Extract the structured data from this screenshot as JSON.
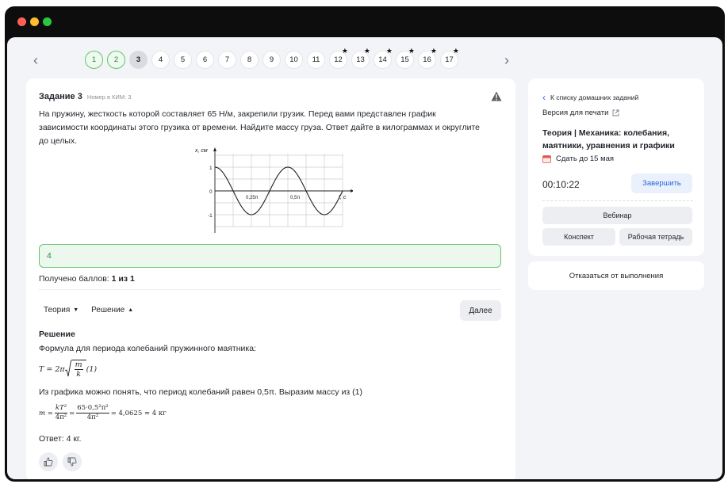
{
  "pager": {
    "pages": [
      {
        "label": "1",
        "state": "done",
        "star": false
      },
      {
        "label": "2",
        "state": "done",
        "star": false
      },
      {
        "label": "3",
        "state": "current",
        "star": false
      },
      {
        "label": "4",
        "state": "default",
        "star": false
      },
      {
        "label": "5",
        "state": "default",
        "star": false
      },
      {
        "label": "6",
        "state": "default",
        "star": false
      },
      {
        "label": "7",
        "state": "default",
        "star": false
      },
      {
        "label": "8",
        "state": "default",
        "star": false
      },
      {
        "label": "9",
        "state": "default",
        "star": false
      },
      {
        "label": "10",
        "state": "default",
        "star": false
      },
      {
        "label": "11",
        "state": "default",
        "star": false
      },
      {
        "label": "12",
        "state": "default",
        "star": true
      },
      {
        "label": "13",
        "state": "default",
        "star": true
      },
      {
        "label": "14",
        "state": "default",
        "star": true
      },
      {
        "label": "15",
        "state": "default",
        "star": true
      },
      {
        "label": "16",
        "state": "default",
        "star": true
      },
      {
        "label": "17",
        "state": "default",
        "star": true
      }
    ]
  },
  "task": {
    "title": "Задание 3",
    "kim": "Номер в КИМ: 3",
    "text": "На пружину, жесткость которой составляет 65 Н/м, закрепили грузик. Перед вами представлен график зависимости координаты этого грузика от времени. Найдите массу груза. Ответ дайте в килограммах и округлите до целых.",
    "answer": "4",
    "score_label": "Получено баллов: ",
    "score_value": "1 из 1"
  },
  "graph": {
    "y_axis_label": "x, см",
    "x_axis_label": "t, c",
    "y_ticks": [
      "1",
      "0",
      "-1"
    ],
    "x_tick_1": "0,25π",
    "x_tick_2": "0,5π"
  },
  "toggles": {
    "theory": "Теория",
    "solution": "Решение",
    "next": "Далее"
  },
  "solution": {
    "title": "Решение",
    "line1": "Формула для периода колебаний пружинного маятника:",
    "f1_left": "T = 2π",
    "f1_num": "m",
    "f1_den": "k",
    "f1_tag": " (1)",
    "line2": "Из графика можно понять, что период колебаний равен 0,5π. Выразим массу из (1)",
    "f2_left": "m =",
    "f2_num1": "kT²",
    "f2_den1": "4π²",
    "f2_eq": "=",
    "f2_num2": "65·0,5²π²",
    "f2_den2": "4π²",
    "f2_result": "= 4,0625 ≈ 4 кг",
    "answer": "Ответ: 4 кг."
  },
  "side": {
    "back": "К списку домашних заданий",
    "print": "Версия для печати",
    "title": "Теория | Механика: колебания, маятники, уравнения и графики",
    "deadline": "Сдать до 15 мая",
    "timer": "00:10:22",
    "finish": "Завершить",
    "webinar": "Вебинар",
    "konspekt": "Конспект",
    "workbook": "Рабочая тетрадь",
    "refuse": "Отказаться от выполнения"
  },
  "colors": {
    "accent": "#2a64d9",
    "success": "#69c36f",
    "background": "#f2f4f8"
  }
}
